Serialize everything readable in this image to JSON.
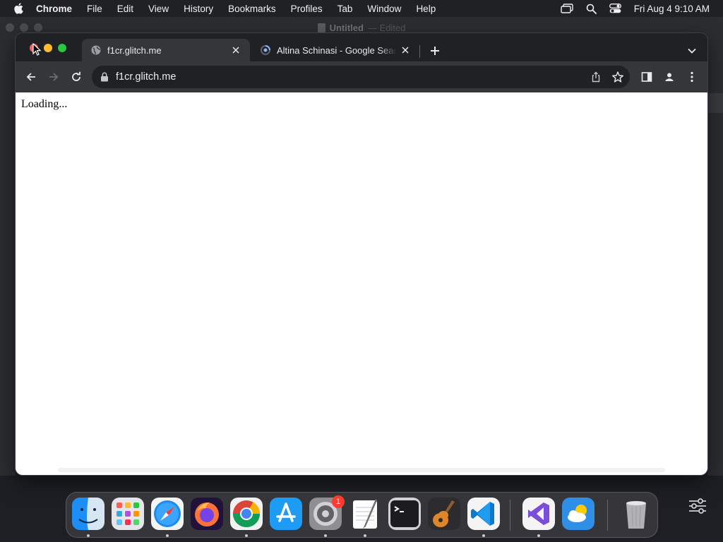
{
  "menubar": {
    "app_name": "Chrome",
    "items": [
      "File",
      "Edit",
      "View",
      "History",
      "Bookmarks",
      "Profiles",
      "Tab",
      "Window",
      "Help"
    ],
    "clock": "Fri Aug 4  9:10 AM",
    "icons": [
      "apple-icon",
      "screen-mirroring-icon",
      "spotlight-icon",
      "control-center-icon"
    ]
  },
  "background_window": {
    "title": "Untitled",
    "subtitle": "— Edited"
  },
  "browser": {
    "tabs": [
      {
        "title": "f1cr.glitch.me",
        "active": true,
        "icon": "globe-icon"
      },
      {
        "title": "Altina Schinasi - Google Search",
        "active": false,
        "icon": "loading-spinner-icon"
      }
    ],
    "address": "f1cr.glitch.me",
    "page": {
      "text": "Loading..."
    }
  },
  "dock": {
    "items": [
      {
        "name": "Finder",
        "running": true
      },
      {
        "name": "Launchpad",
        "running": false
      },
      {
        "name": "Safari",
        "running": true
      },
      {
        "name": "Firefox",
        "running": false
      },
      {
        "name": "Google Chrome",
        "running": true
      },
      {
        "name": "App Store",
        "running": false
      },
      {
        "name": "System Settings",
        "running": true,
        "badge": "1"
      },
      {
        "name": "TextEdit",
        "running": true
      },
      {
        "name": "Terminal",
        "running": false
      },
      {
        "name": "GarageBand",
        "running": false
      },
      {
        "name": "Visual Studio Code",
        "running": true
      },
      {
        "name": "Visual Studio",
        "running": true
      },
      {
        "name": "Weather",
        "running": false
      },
      {
        "name": "Trash",
        "running": false
      }
    ]
  },
  "colors": {
    "menubar_bg": "#202124",
    "tab_active_bg": "#35363a",
    "close_light": "#ff5f57",
    "min_light": "#febc2e",
    "max_light": "#28c840",
    "badge": "#ff3b30"
  }
}
